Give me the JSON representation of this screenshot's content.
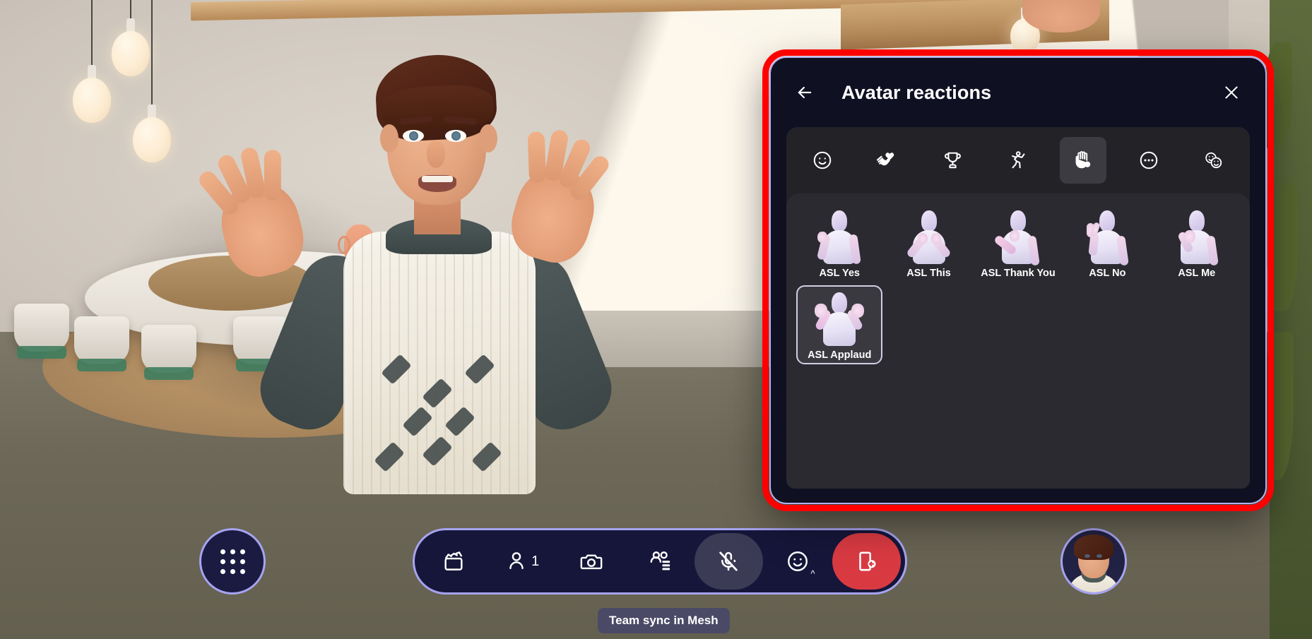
{
  "app": {
    "scene_name": "Microsoft Mesh immersive space",
    "status_pill": "Team sync in Mesh"
  },
  "panel": {
    "title": "Avatar reactions",
    "back_icon": "arrow-left-icon",
    "close_icon": "close-icon",
    "accent_border_color": "#b4b0f0",
    "highlight_color": "#fe0000",
    "background_color": "#0f1021",
    "body_color": "#232227",
    "grid_color": "#2b2a30",
    "tabs": [
      {
        "id": "emotions",
        "icon": "smiley-face-icon",
        "label": "Emotions",
        "selected": false
      },
      {
        "id": "applause",
        "icon": "hand-heart-applause-icon",
        "label": "Applause",
        "selected": false
      },
      {
        "id": "celebrate",
        "icon": "trophy-icon",
        "label": "Celebrate",
        "selected": false
      },
      {
        "id": "dance",
        "icon": "dancing-person-icon",
        "label": "Dance",
        "selected": false
      },
      {
        "id": "signs",
        "icon": "hand-sign-language-icon",
        "label": "Signs",
        "selected": true
      },
      {
        "id": "more",
        "icon": "more-ellipsis-icon",
        "label": "More",
        "selected": false
      },
      {
        "id": "stickers",
        "icon": "double-smiley-icon",
        "label": "Stickers",
        "selected": false
      }
    ],
    "reactions": [
      {
        "label": "ASL Yes",
        "icon": "avatar-asl-yes-icon",
        "selected": false,
        "pose": "fist-raised"
      },
      {
        "label": "ASL This",
        "icon": "avatar-asl-this-icon",
        "selected": false,
        "pose": "both-hands-center"
      },
      {
        "label": "ASL Thank You",
        "icon": "avatar-asl-thankyou-icon",
        "selected": false,
        "pose": "hand-to-chin"
      },
      {
        "label": "ASL No",
        "icon": "avatar-asl-no-icon",
        "selected": false,
        "pose": "two-fingers-up"
      },
      {
        "label": "ASL Me",
        "icon": "avatar-asl-me-icon",
        "selected": false,
        "pose": "point-to-self"
      },
      {
        "label": "ASL Applaud",
        "icon": "avatar-asl-applaud-icon",
        "selected": true,
        "pose": "both-hands-up"
      }
    ]
  },
  "toolbar": {
    "apps_button": {
      "label": "Apps",
      "icon": "grid-dots-icon"
    },
    "buttons": [
      {
        "id": "content",
        "icon": "clapperboard-icon",
        "label": "Share content",
        "badge": "",
        "state": "default"
      },
      {
        "id": "participants",
        "icon": "person-icon",
        "label": "People",
        "badge": "1",
        "state": "default"
      },
      {
        "id": "camera",
        "icon": "camera-icon",
        "label": "Camera",
        "badge": "",
        "state": "default"
      },
      {
        "id": "view",
        "icon": "people-view-icon",
        "label": "View",
        "badge": "",
        "state": "default"
      },
      {
        "id": "mic",
        "icon": "microphone-muted-icon",
        "label": "Unmute",
        "badge": "",
        "state": "active-muted"
      },
      {
        "id": "reactions",
        "icon": "smiley-face-icon",
        "label": "Reactions",
        "badge": "",
        "state": "has-caret"
      },
      {
        "id": "leave",
        "icon": "leave-door-icon",
        "label": "Leave",
        "badge": "",
        "state": "danger"
      }
    ],
    "self_avatar": {
      "label": "Your avatar",
      "icon": "self-avatar-icon"
    },
    "accent_color": "#a6a4f0",
    "leave_color": "#d93a42"
  }
}
